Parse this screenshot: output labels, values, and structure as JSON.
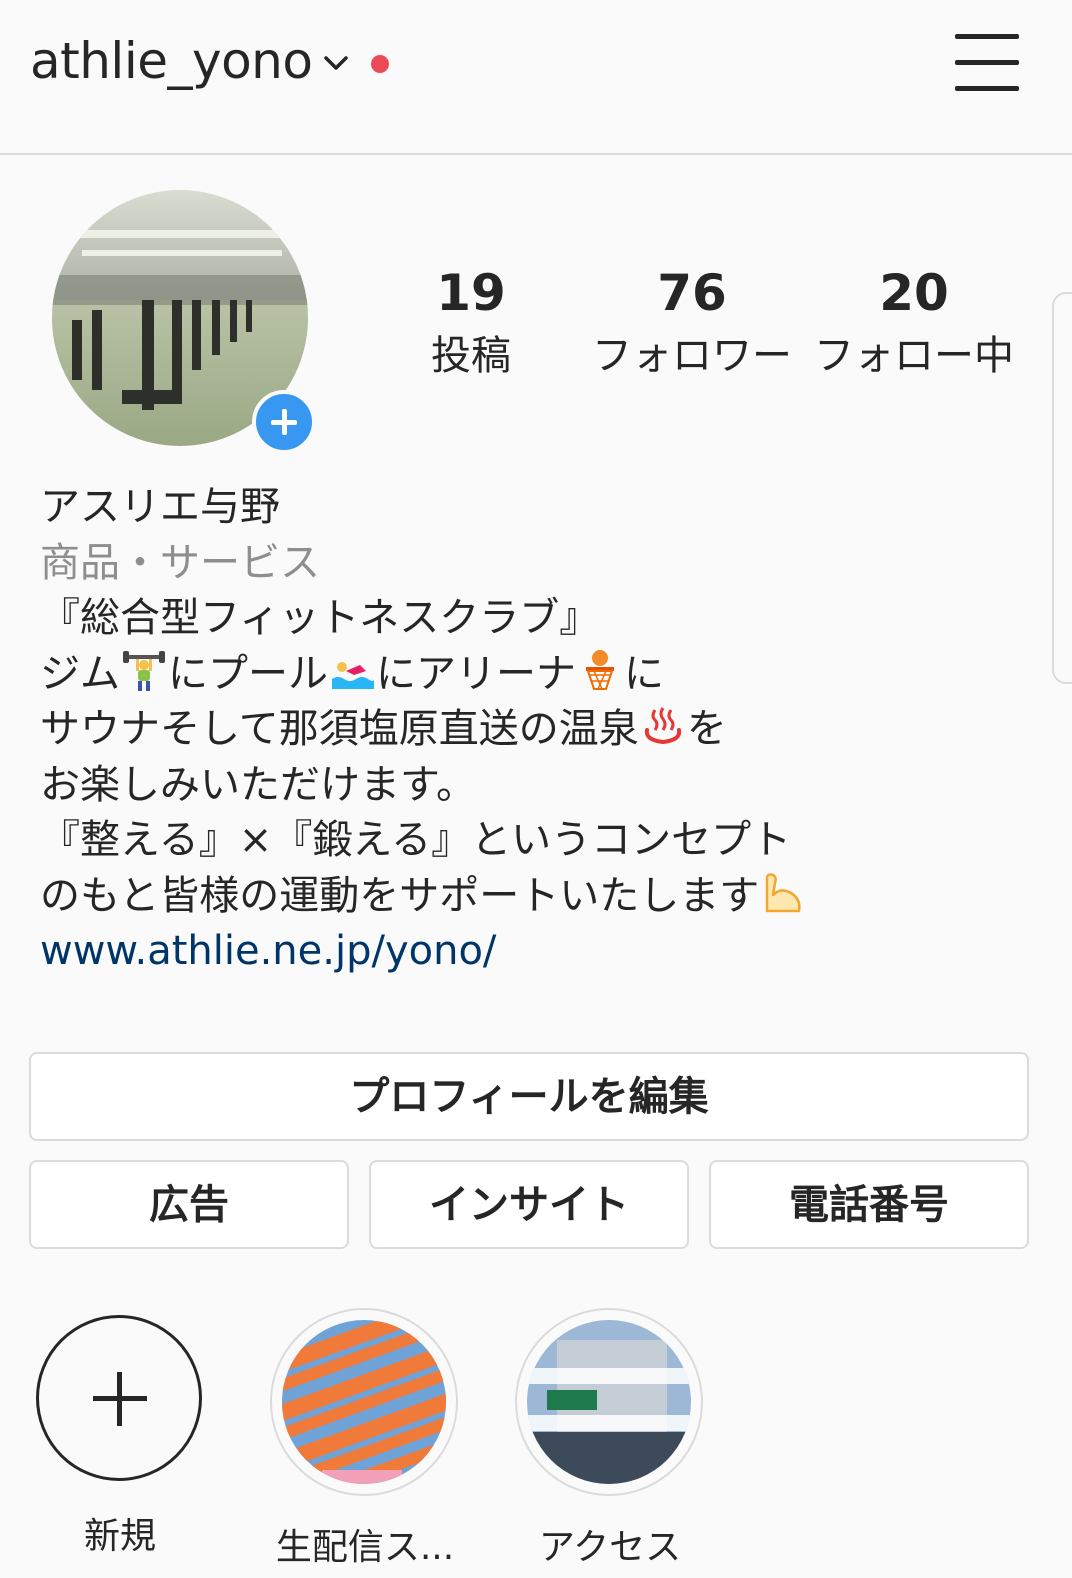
{
  "header": {
    "username": "athlie_yono",
    "dropdown_icon": "chevron-down-icon",
    "notification_dot_color": "#ed4956",
    "menu_icon": "hamburger-menu-icon"
  },
  "profile": {
    "stats": [
      {
        "value": "19",
        "label": "投稿"
      },
      {
        "value": "76",
        "label": "フォロワー"
      },
      {
        "value": "20",
        "label": "フォロー中"
      }
    ]
  },
  "bio": {
    "name": "アスリエ与野",
    "category": "商品・サービス",
    "line1": "『総合型フィットネスクラブ』",
    "line2_a": "ジム",
    "line2_b": "にプール",
    "line2_c": "にアリーナ",
    "line2_d": "に",
    "line3_a": "サウナそして那須塩原直送の温泉",
    "line3_b": "を",
    "line4": "お楽しみいただけます。",
    "line5": "『整える』×『鍛える』というコンセプト",
    "line6": "のもと皆様の運動をサポートいたします",
    "website": "www.athlie.ne.jp/yono/"
  },
  "buttons": {
    "edit_profile": "プロフィールを編集",
    "ads": "広告",
    "insights": "インサイト",
    "phone": "電話番号"
  },
  "highlights": [
    {
      "label": "新規"
    },
    {
      "label": "生配信ス..."
    },
    {
      "label": "アクセス"
    }
  ],
  "colors": {
    "accent_blue": "#3897f0",
    "link": "#003569",
    "muted": "#8e8e8e"
  }
}
